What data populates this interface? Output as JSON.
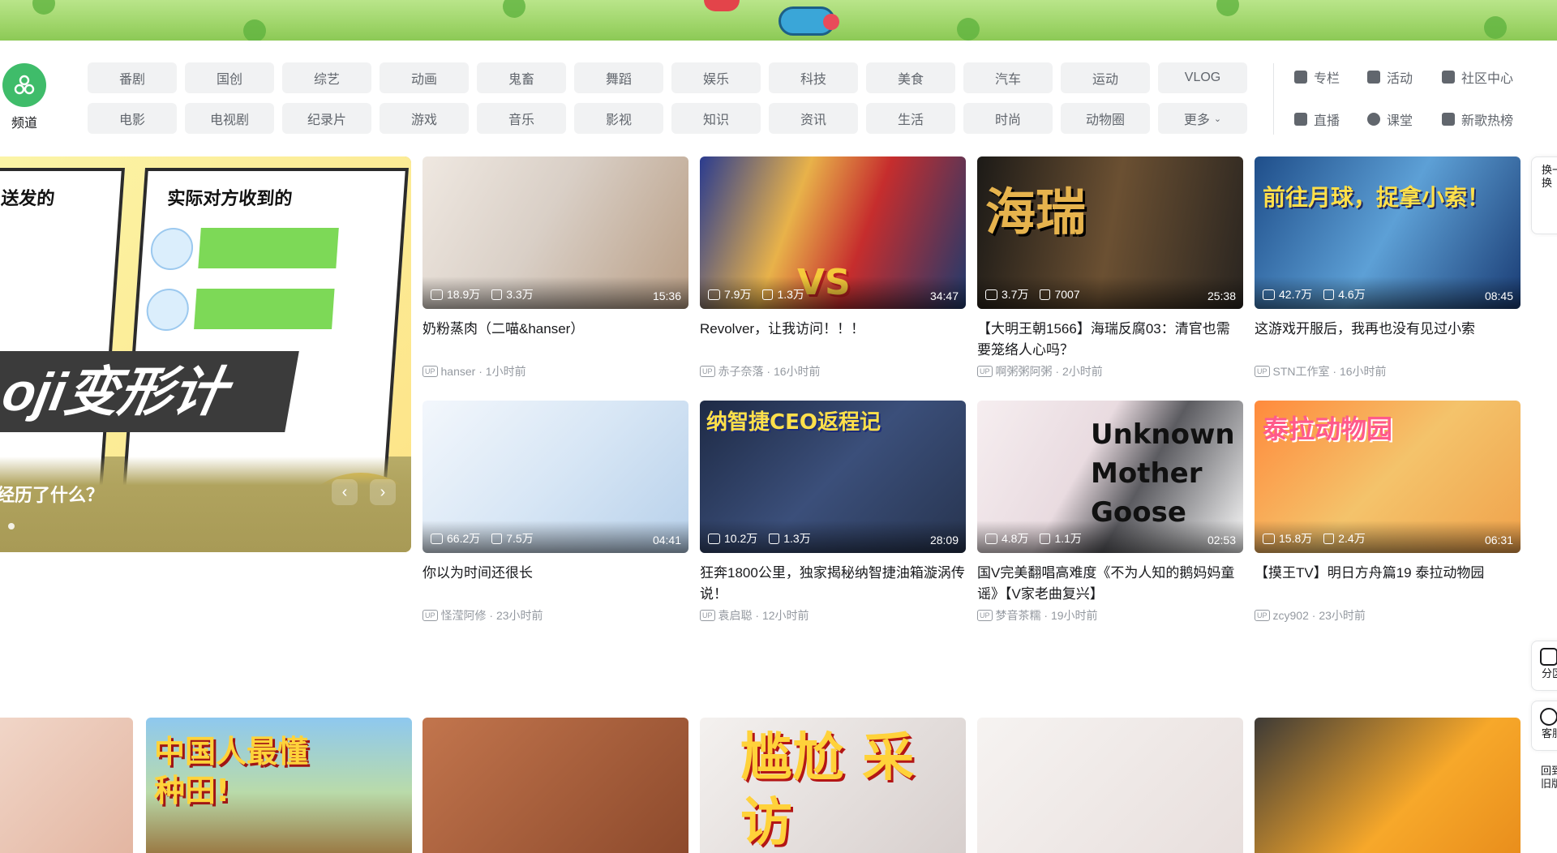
{
  "channel": {
    "label": "频道"
  },
  "nav_row1": [
    "番剧",
    "国创",
    "综艺",
    "动画",
    "鬼畜",
    "舞蹈",
    "娱乐",
    "科技",
    "美食",
    "汽车",
    "运动",
    "VLOG"
  ],
  "nav_row2": [
    "电影",
    "电视剧",
    "纪录片",
    "游戏",
    "音乐",
    "影视",
    "知识",
    "资讯",
    "生活",
    "时尚",
    "动物圈",
    "更多"
  ],
  "quick_links": [
    "专栏",
    "活动",
    "社区中心",
    "直播",
    "课堂",
    "新歌热榜"
  ],
  "carousel": {
    "panel_left_head": "送发的",
    "panel_right_head": "实际对方收到的",
    "art_text": "oji变形计",
    "caption": "经历了什么？",
    "prev": "‹",
    "next": "›"
  },
  "videos": [
    {
      "title": "奶粉蒸肉（二喵&hanser）",
      "author": "hanser",
      "time": "1小时前",
      "views": "18.9万",
      "likes": "3.3万",
      "duration": "15:36",
      "art": ""
    },
    {
      "title": "Revolver，让我访问！！！",
      "author": "赤子奈落",
      "time": "16小时前",
      "views": "7.9万",
      "likes": "1.3万",
      "duration": "34:47",
      "art": "VS"
    },
    {
      "title": "【大明王朝1566】海瑞反腐03：清官也需要笼络人心吗？",
      "author": "啊粥粥阿粥",
      "time": "2小时前",
      "views": "3.7万",
      "likes": "7007",
      "duration": "25:38",
      "art": "海瑞"
    },
    {
      "title": "这游戏开服后，我再也没有见过小索",
      "author": "STN工作室",
      "time": "16小时前",
      "views": "42.7万",
      "likes": "4.6万",
      "duration": "08:45",
      "art": "前往月球，捉拿小索！"
    },
    {
      "title": "你以为时间还很长",
      "author": "怪滢阿修",
      "time": "23小时前",
      "views": "66.2万",
      "likes": "7.5万",
      "duration": "04:41",
      "art": ""
    },
    {
      "title": "狂奔1800公里，独家揭秘纳智捷油箱漩涡传说！",
      "author": "袁启聪",
      "time": "12小时前",
      "views": "10.2万",
      "likes": "1.3万",
      "duration": "28:09",
      "art": "纳智捷CEO返程记"
    },
    {
      "title": "国V完美翻唱高难度《不为人知的鹅妈妈童谣》【V家老曲复兴】",
      "author": "梦音茶糯",
      "time": "19小时前",
      "views": "4.8万",
      "likes": "1.1万",
      "duration": "02:53",
      "art": "Unknown Mother Goose"
    },
    {
      "title": "【摸王TV】明日方舟篇19 泰拉动物园",
      "author": "zcy902",
      "time": "23小时前",
      "views": "15.8万",
      "likes": "2.4万",
      "duration": "06:31",
      "art": "泰拉动物园"
    }
  ],
  "bottom_art": [
    "",
    "中国人最懂种田!",
    "",
    "尴尬 采访",
    "",
    ""
  ],
  "rail": {
    "swap": "换一换",
    "zone": "分区",
    "service": "客服",
    "back": "回到旧版"
  },
  "colors": {
    "accent": "#00aeec",
    "channel_green": "#3fbc6a",
    "tag_bg": "#f1f2f3"
  }
}
